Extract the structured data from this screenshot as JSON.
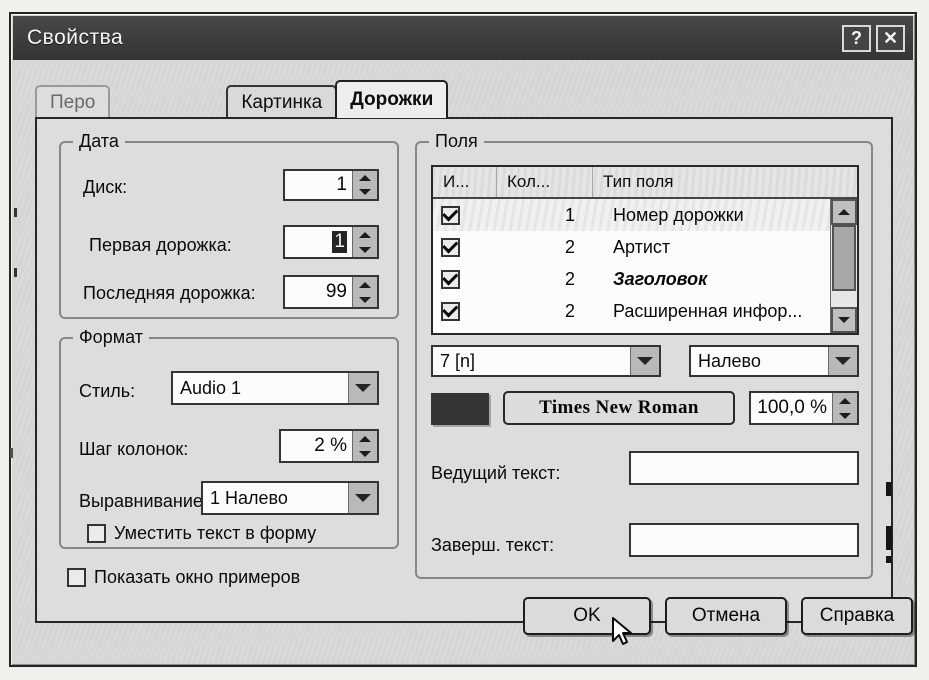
{
  "window": {
    "title": "Свойства",
    "help_button": "?",
    "close_button": "✕",
    "help_icon_name": "help-icon",
    "close_icon_name": "close-icon"
  },
  "tabs": [
    {
      "label": "Перо",
      "active": false
    },
    {
      "label": "Картинка",
      "active": false
    },
    {
      "label": "Дорожки",
      "active": true
    }
  ],
  "groups": {
    "data": {
      "legend": "Дата",
      "fields": [
        {
          "label": "Диск:",
          "value": "1",
          "selected": false
        },
        {
          "label": "Первая дорожка:",
          "value": "1",
          "selected": true
        },
        {
          "label": "Последняя дорожка:",
          "value": "99",
          "selected": false
        }
      ]
    },
    "format": {
      "legend": "Формат",
      "style_label": "Стиль:",
      "style_value": "Audio 1",
      "column_step_label": "Шаг колонок:",
      "column_step_value": "2 %",
      "align_label": "Выравнивание:",
      "align_value": "1 Налево",
      "fit_text_checkbox": "Уместить текст в форму",
      "fit_text_checked": false
    },
    "fields": {
      "legend": "Поля",
      "columns": [
        "И...",
        "Кол...",
        "Тип поля"
      ],
      "rows": [
        {
          "checked": true,
          "count": "1",
          "type": "Номер дорожки",
          "italic": false,
          "selected": true
        },
        {
          "checked": true,
          "count": "2",
          "type": "Артист",
          "italic": false,
          "selected": false
        },
        {
          "checked": true,
          "count": "2",
          "type": "Заголовок",
          "italic": true,
          "selected": false
        },
        {
          "checked": true,
          "count": "2",
          "type": "Расширенная инфор...",
          "italic": false,
          "selected": false
        }
      ],
      "combo_width_value": "7 [n]",
      "combo_align_value": "Налево",
      "font_button": "Times  New Roman",
      "font_color": "#3b3a38",
      "scale_value": "100,0 %",
      "leading_text_label": "Ведущий текст:",
      "leading_text_value": "",
      "trailing_text_label": "Заверш. текст:",
      "trailing_text_value": ""
    }
  },
  "preview_checkbox": {
    "label": "Показать окно примеров",
    "checked": false
  },
  "buttons": {
    "ok": "OK",
    "cancel": "Отмена",
    "help": "Справка"
  }
}
